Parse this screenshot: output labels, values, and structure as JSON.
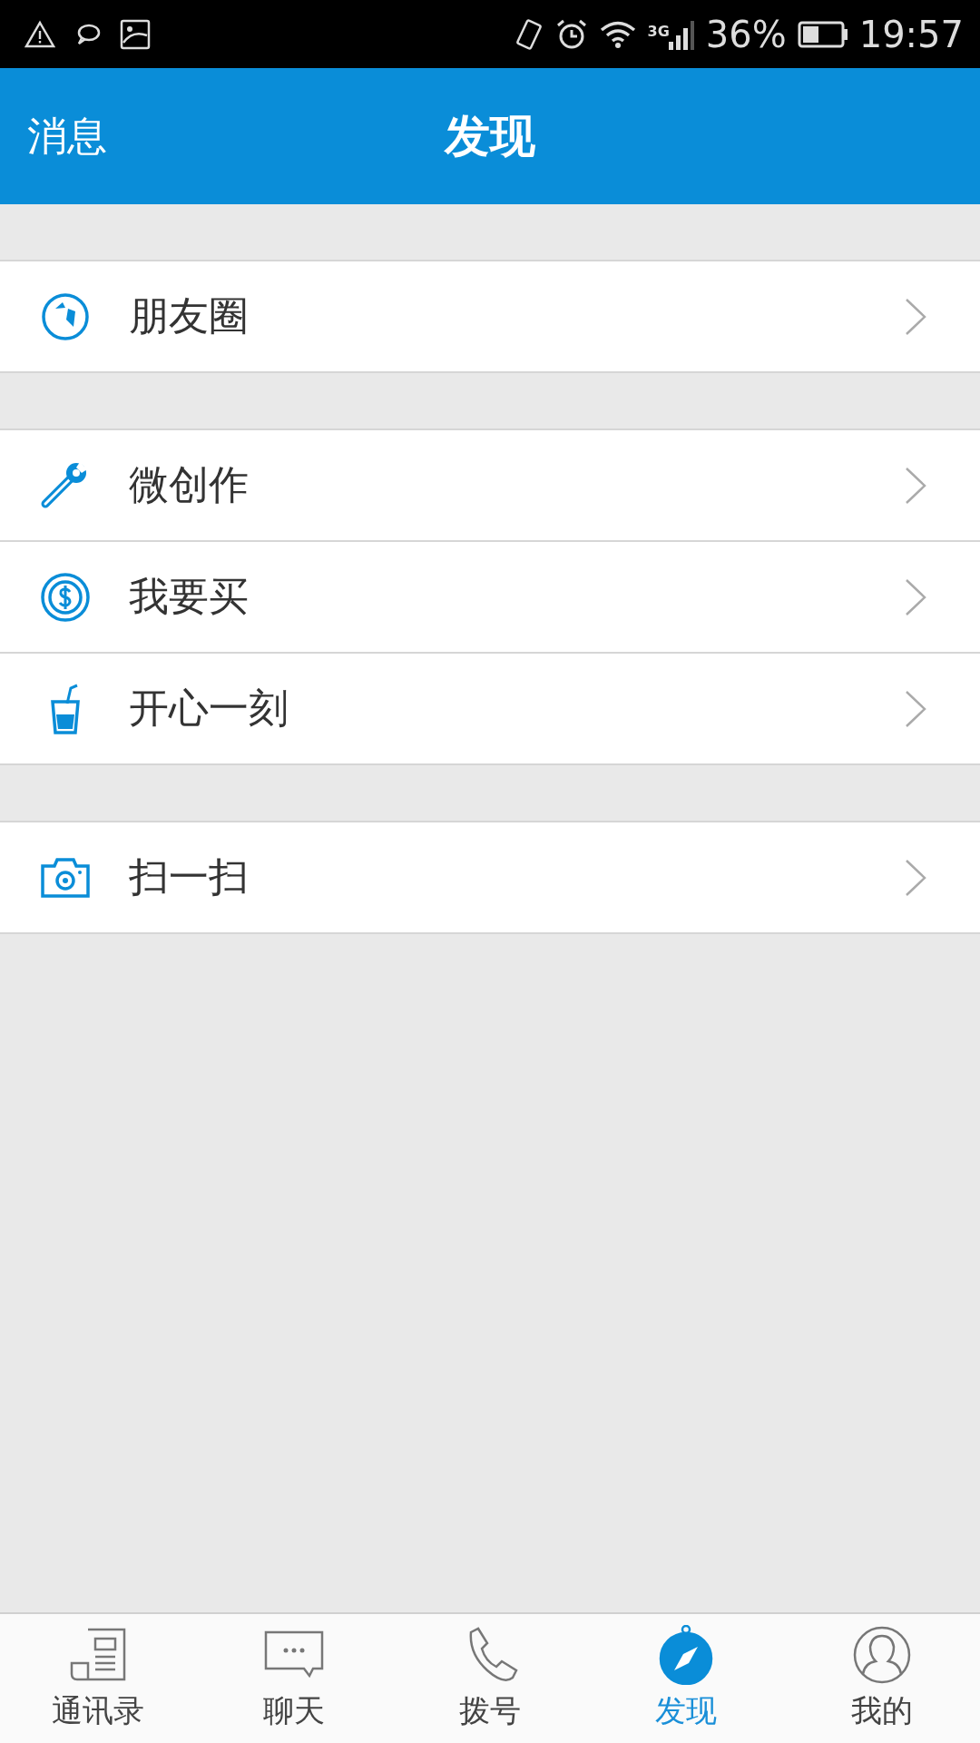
{
  "status_bar": {
    "network": "3G",
    "battery": "36%",
    "time": "19:57"
  },
  "header": {
    "back": "消息",
    "title": "发现"
  },
  "sections": [
    {
      "items": [
        {
          "label": "朋友圈"
        }
      ]
    },
    {
      "items": [
        {
          "label": "微创作"
        },
        {
          "label": "我要买"
        },
        {
          "label": "开心一刻"
        }
      ]
    },
    {
      "items": [
        {
          "label": "扫一扫"
        }
      ]
    }
  ],
  "tabs": [
    {
      "label": "通讯录",
      "selected": false
    },
    {
      "label": "聊天",
      "selected": false
    },
    {
      "label": "拨号",
      "selected": false
    },
    {
      "label": "发现",
      "selected": true
    },
    {
      "label": "我的",
      "selected": false
    }
  ]
}
